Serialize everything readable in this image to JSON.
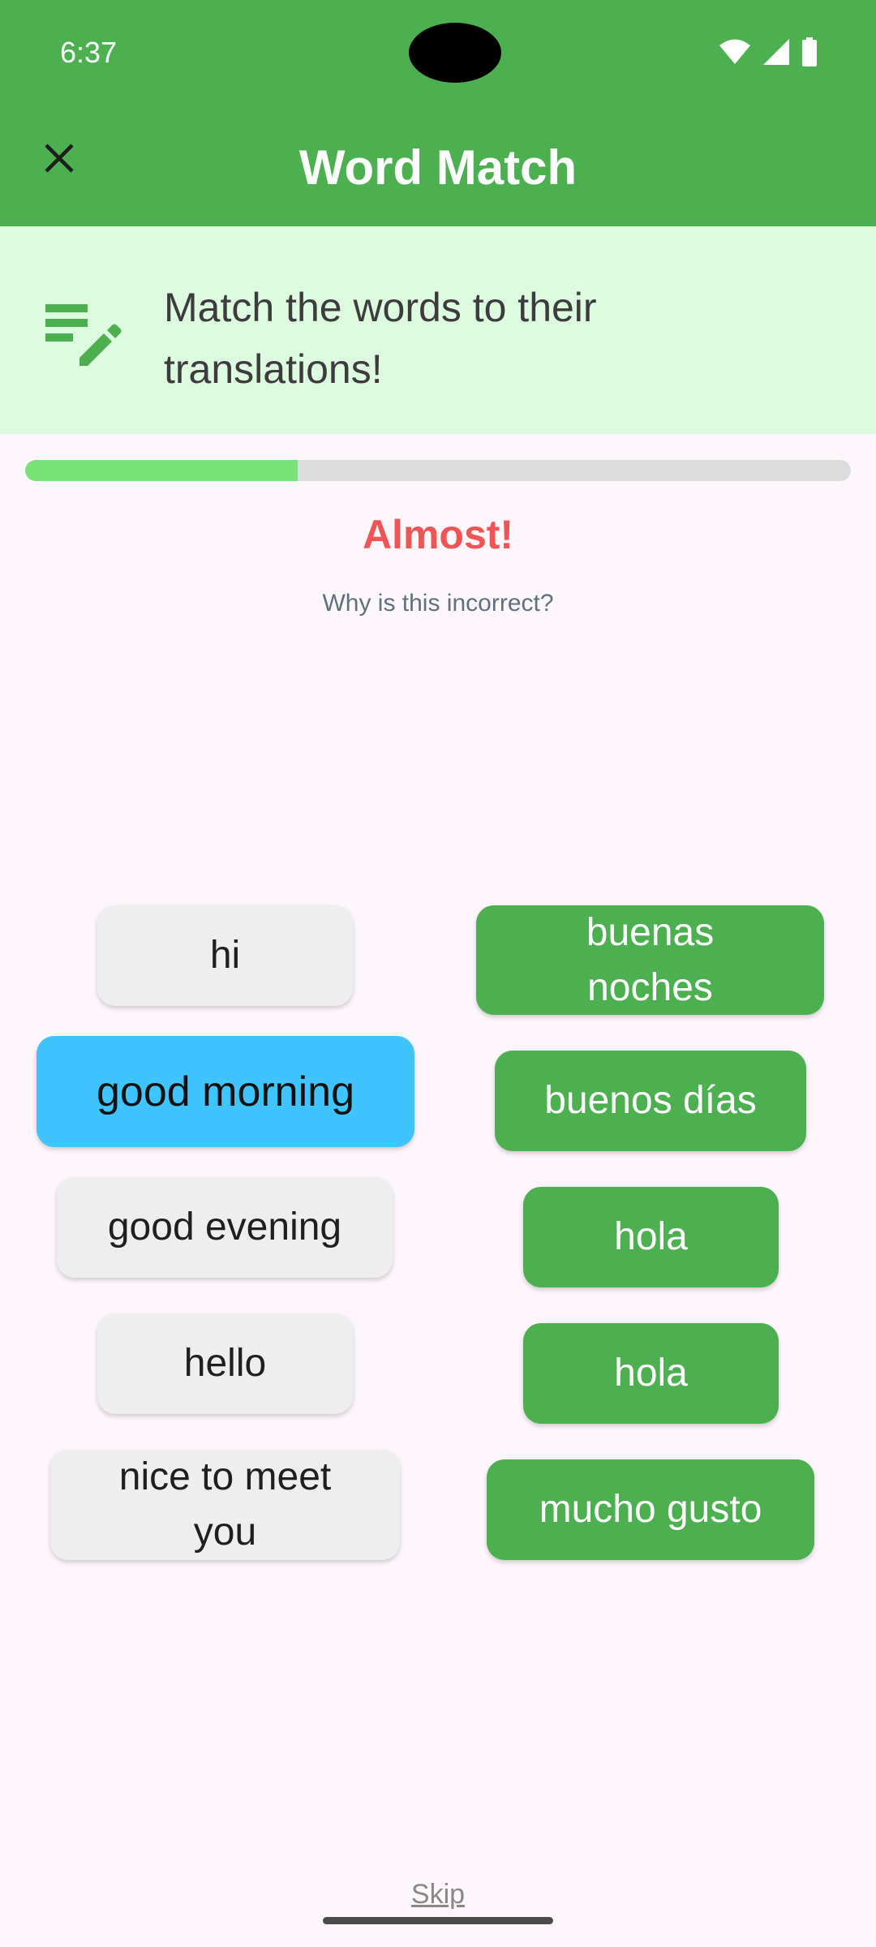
{
  "status_bar": {
    "time": "6:37"
  },
  "app_bar": {
    "title": "Word Match",
    "close_icon": "close-icon"
  },
  "instruction": {
    "icon": "edit-note-icon",
    "text": "Match the words to their translations!"
  },
  "progress": {
    "fraction": 0.33,
    "fill_color": "#78E478",
    "track_color": "#DCDCDC"
  },
  "feedback": {
    "title": "Almost!",
    "link": "Why is this incorrect?",
    "title_color": "#F05454"
  },
  "english_words": [
    {
      "label": "hi",
      "selected": false
    },
    {
      "label": "good morning",
      "selected": true
    },
    {
      "label": "good evening",
      "selected": false
    },
    {
      "label": "hello",
      "selected": false
    },
    {
      "label": "nice to meet you",
      "selected": false
    }
  ],
  "spanish_words": [
    {
      "label": "buenas noches",
      "matched": true
    },
    {
      "label": "buenos días",
      "matched": true
    },
    {
      "label": "hola",
      "matched": true
    },
    {
      "label": "hola",
      "matched": true
    },
    {
      "label": "mucho gusto",
      "matched": true
    }
  ],
  "footer": {
    "skip_label": "Skip"
  },
  "colors": {
    "primary": "#4CAF50",
    "selected": "#40C4FF",
    "neutral_tile": "#EEEEEE",
    "banner": "#DCFBDF"
  }
}
